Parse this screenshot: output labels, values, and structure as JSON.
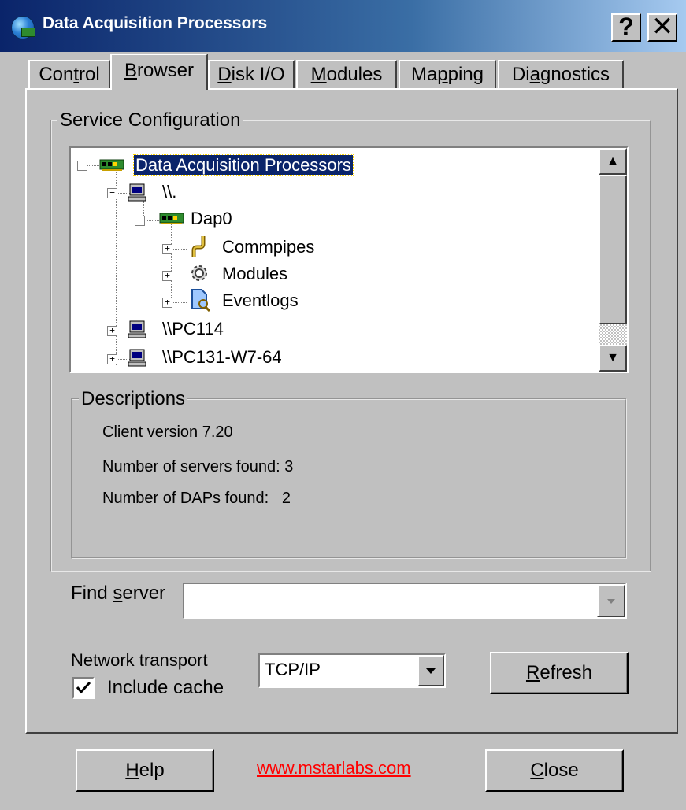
{
  "window": {
    "title": "Data Acquisition Processors",
    "help_button": "?",
    "close_button": "✕"
  },
  "tabs": [
    {
      "label": "Control",
      "accel": "t",
      "active": false
    },
    {
      "label": "Browser",
      "accel": "B",
      "active": true
    },
    {
      "label": "Disk I/O",
      "accel": "D",
      "active": false
    },
    {
      "label": "Modules",
      "accel": "M",
      "active": false
    },
    {
      "label": "Mapping",
      "accel": "p",
      "active": false
    },
    {
      "label": "Diagnostics",
      "accel": "a",
      "active": false
    }
  ],
  "service_configuration": {
    "legend": "Service Configuration",
    "tree": [
      {
        "label": "Data Acquisition Processors",
        "icon": "dap-board-icon",
        "selected": true,
        "expanded": true
      },
      {
        "label": "\\\\.",
        "icon": "computer-icon",
        "expanded": true
      },
      {
        "label": "Dap0",
        "icon": "dap-board-icon",
        "expanded": true
      },
      {
        "label": "Commpipes",
        "icon": "pipe-icon",
        "expanded": false
      },
      {
        "label": "Modules",
        "icon": "gear-icon",
        "expanded": false
      },
      {
        "label": "Eventlogs",
        "icon": "eventlog-icon",
        "expanded": false
      },
      {
        "label": "\\\\PC114",
        "icon": "computer-icon",
        "expanded": false
      },
      {
        "label": "\\\\PC131-W7-64",
        "icon": "computer-icon",
        "expanded": false
      }
    ]
  },
  "descriptions": {
    "legend": "Descriptions",
    "lines": [
      "Client version 7.20",
      "Number of servers found: 3",
      "Number of DAPs found:   2"
    ]
  },
  "find_server": {
    "label_pre": "Find ",
    "label_accel": "s",
    "label_post": "erver",
    "value": ""
  },
  "network": {
    "transport_label": "Network transport",
    "include_cache_label": "Include cache",
    "include_cache_checked": true,
    "transport_value": "TCP/IP",
    "refresh_accel": "R",
    "refresh_rest": "efresh"
  },
  "footer": {
    "help_accel": "H",
    "help_rest": "elp",
    "link": "www.mstarlabs.com",
    "link_color": "#ff0000",
    "close_accel": "C",
    "close_rest": "lose"
  }
}
